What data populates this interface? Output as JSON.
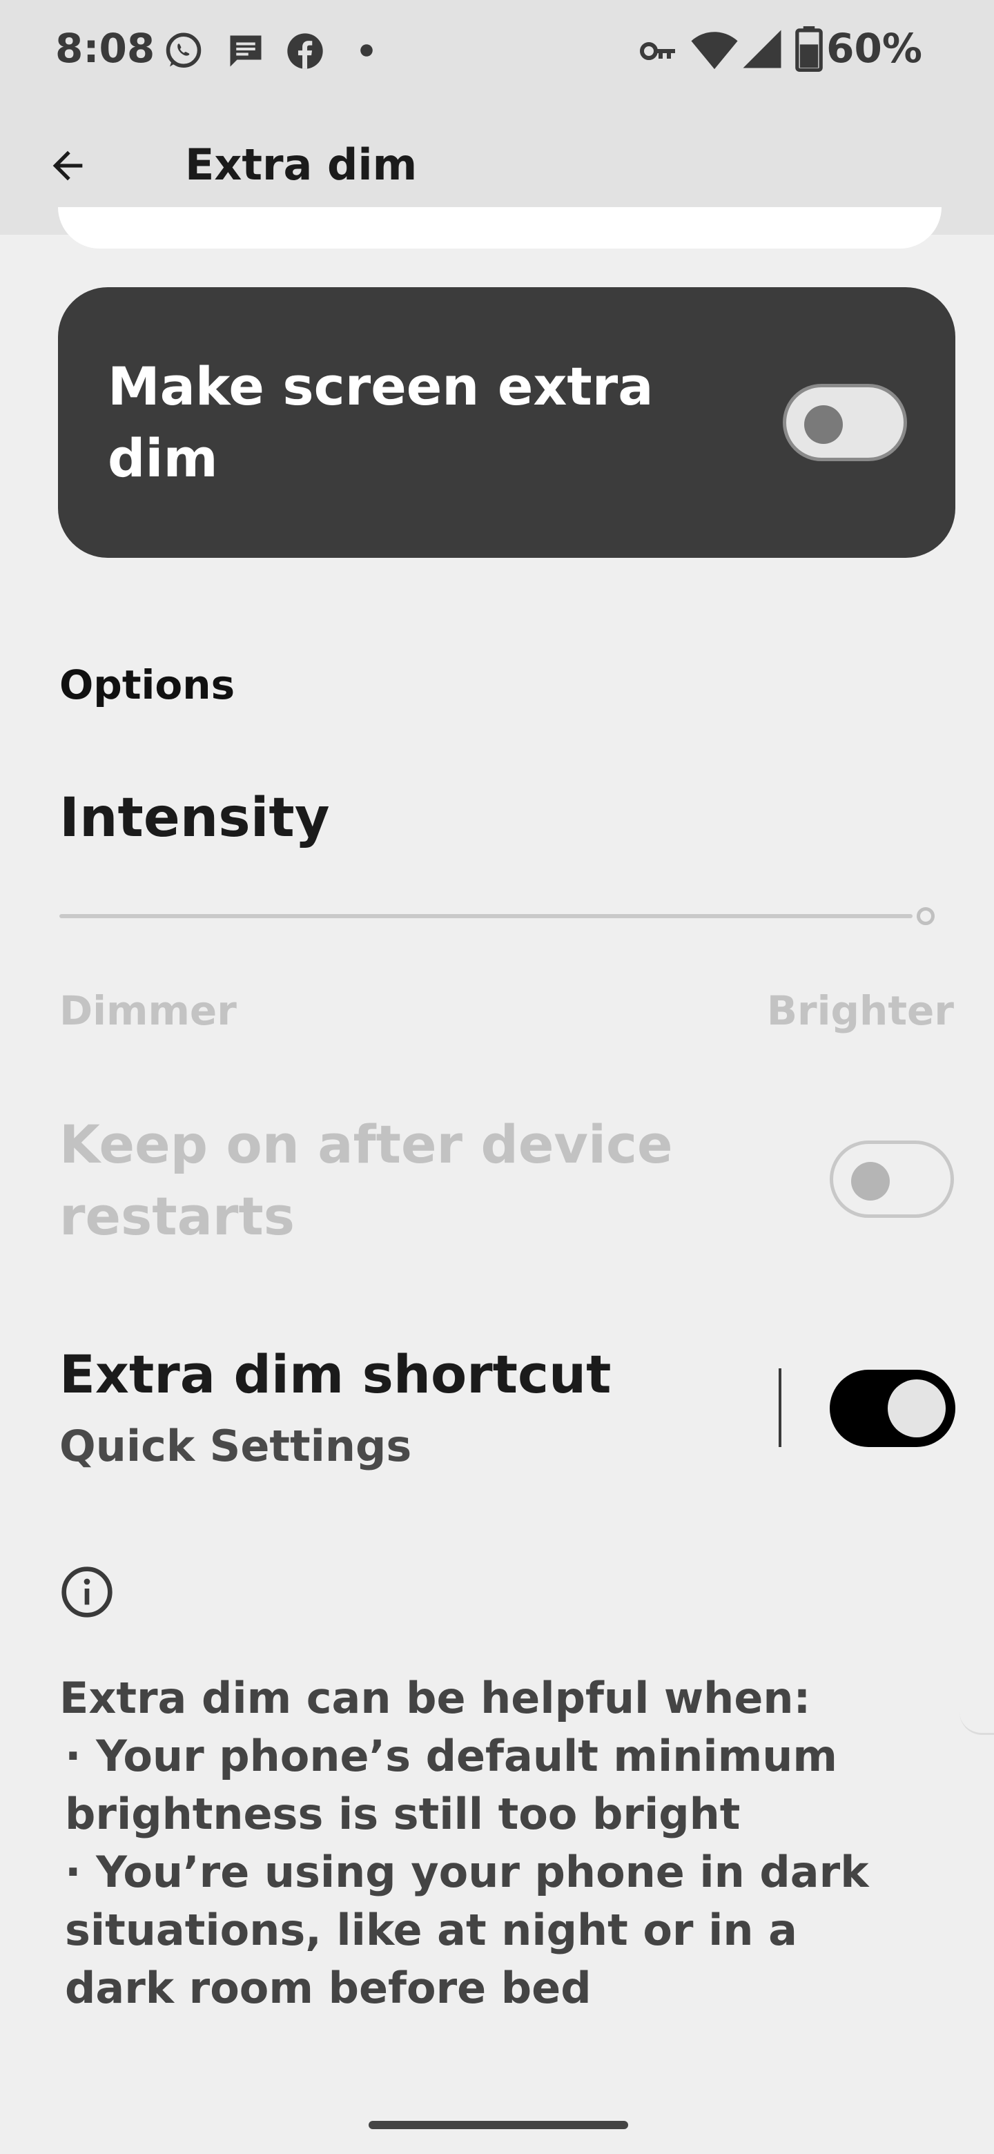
{
  "status_bar": {
    "time": "8:08",
    "battery_percent": "60%",
    "icons": [
      "whatsapp-icon",
      "message-icon",
      "facebook-icon",
      "dot-icon",
      "vpn-key-icon",
      "wifi-icon",
      "cellular-signal-icon",
      "battery-icon"
    ]
  },
  "app_bar": {
    "title": "Extra dim",
    "back_icon": "arrow-left-icon"
  },
  "main_toggle": {
    "label": "Make screen extra dim",
    "checked": false
  },
  "options": {
    "header": "Options",
    "intensity": {
      "title": "Intensity",
      "min_label": "Dimmer",
      "max_label": "Brighter",
      "value_fraction": 1.0,
      "enabled": false
    },
    "keep_on": {
      "label": "Keep on after device restarts",
      "checked": false,
      "enabled": false
    },
    "shortcut": {
      "title": "Extra dim shortcut",
      "summary": "Quick Settings",
      "checked": true
    }
  },
  "footer": {
    "info_icon": "info-icon",
    "intro": "Extra dim can be helpful when:",
    "bullets": [
      "· Your phone’s default minimum brightness is still too bright",
      "· You’re using your phone in dark situations, like at night or in a dark room before bed"
    ]
  },
  "colors": {
    "background": "#efefef",
    "topbar": "#e2e2e2",
    "card": "#3c3c3c",
    "switch_on": "#000000",
    "disabled_text": "#c2c2c2"
  }
}
